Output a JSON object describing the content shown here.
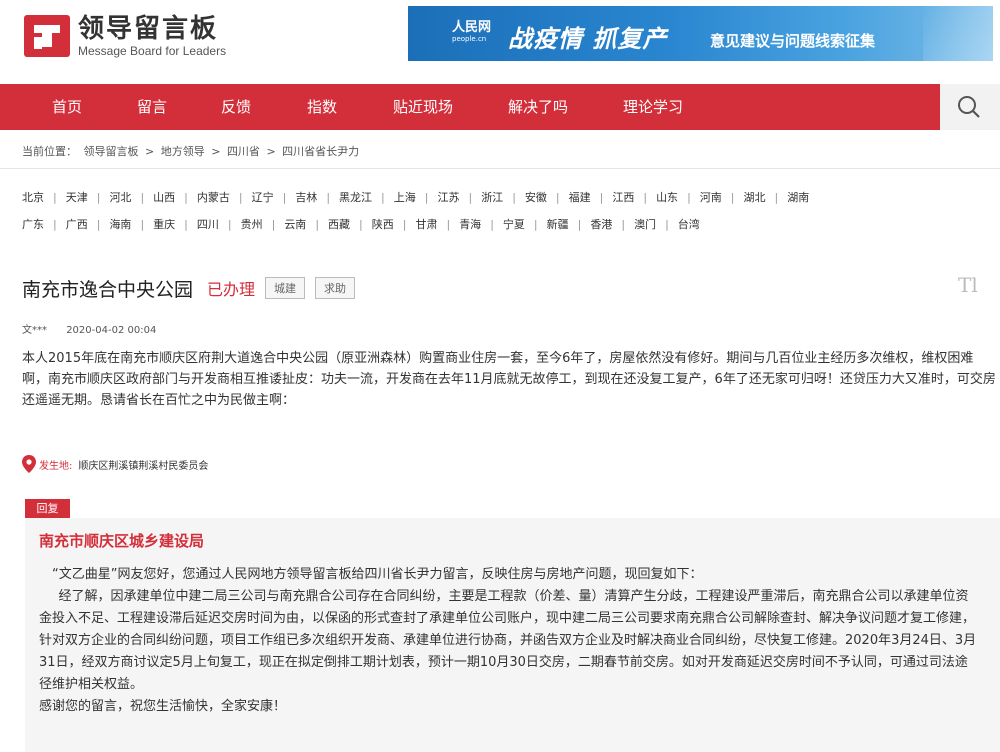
{
  "header": {
    "logo_cn": "领导留言板",
    "logo_en": "Message Board for Leaders",
    "banner_brand": "人民网",
    "banner_brand_sub": "people.cn",
    "banner_big": "战疫情  抓复产",
    "banner_small": "意见建议与问题线索征集"
  },
  "nav": {
    "items": [
      "首页",
      "留言",
      "反馈",
      "指数",
      "贴近现场",
      "解决了吗",
      "理论学习"
    ],
    "search_icon": "search-icon"
  },
  "breadcrumb": {
    "label": "当前位置：",
    "items": [
      "领导留言板",
      ">",
      "地方领导",
      ">",
      "四川省",
      ">",
      "四川省省长尹力"
    ]
  },
  "provinces": {
    "row1": [
      "北京",
      "天津",
      "河北",
      "山西",
      "内蒙古",
      "辽宁",
      "吉林",
      "黑龙江",
      "上海",
      "江苏",
      "浙江",
      "安徽",
      "福建",
      "江西",
      "山东",
      "河南",
      "湖北",
      "湖南"
    ],
    "row2": [
      "广东",
      "广西",
      "海南",
      "重庆",
      "四川",
      "贵州",
      "云南",
      "西藏",
      "陕西",
      "甘肃",
      "青海",
      "宁夏",
      "新疆",
      "香港",
      "澳门",
      "台湾"
    ]
  },
  "message": {
    "title": "南充市逸合中央公园",
    "status": "已办理",
    "tags": [
      "城建",
      "求助"
    ],
    "font_icon": "Tl",
    "author": "文***",
    "date": "2020-04-02 00:04",
    "content": "本人2015年底在南充市顺庆区府荆大道逸合中央公园（原亚洲森林）购置商业住房一套，至今6年了，房屋依然没有修好。期间与几百位业主经历多次维权，维权困难啊，南充市顺庆区政府部门与开发商相互推诿扯皮：功夫一流，开发商在去年11月底就无故停工，到现在还没复工复产，6年了还无家可归呀！还贷压力大又准时，可交房还遥遥无期。恳请省长在百忙之中为民做主啊：",
    "location_label": "发生地:",
    "location_value": "顺庆区荆溪镇荆溪村民委员会"
  },
  "reply": {
    "tag": "回复",
    "org": "南充市顺庆区城乡建设局",
    "p1": "“文乙曲星”网友您好，您通过人民网地方领导留言板给四川省长尹力留言，反映住房与房地产问题，现回复如下：",
    "p2": "经了解，因承建单位中建二局三公司与南充鼎合公司存在合同纠纷，主要是工程款（价差、量）清算产生分歧，工程建设严重滞后，南充鼎合公司以承建单位资金投入不足、工程建设滞后延迟交房时间为由，以保函的形式查封了承建单位公司账户，现中建二局三公司要求南充鼎合公司解除查封、解决争议问题才复工修建，针对双方企业的合同纠纷问题，项目工作组已多次组织开发商、承建单位进行协商，并函告双方企业及时解决商业合同纠纷，尽快复工修建。2020年3月24日、3月31日，经双方商讨议定5月上旬复工，现正在拟定倒排工期计划表，预计一期10月30日交房，二期春节前交房。如对开发商延迟交房时间不予认同，可通过司法途径维护相关权益。",
    "p3": "感谢您的留言，祝您生活愉快，全家安康！"
  },
  "colors": {
    "brand_red": "#d32f3b",
    "nav_bg": "#d32f3b",
    "banner_blue": "#1b6fb8"
  }
}
